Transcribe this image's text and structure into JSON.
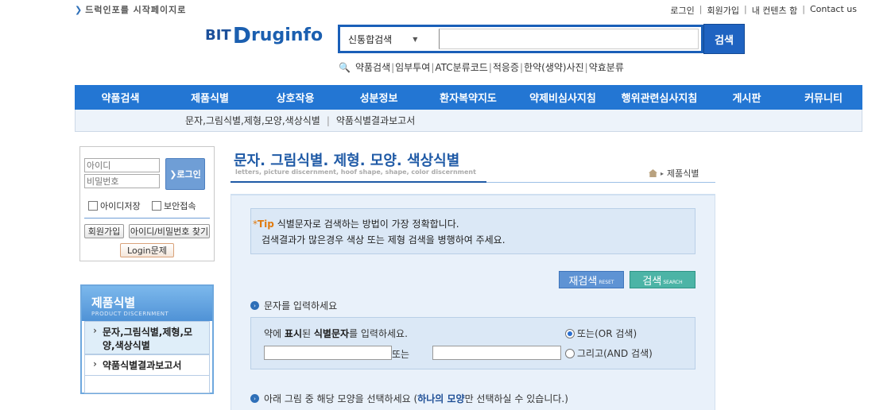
{
  "top": {
    "start_page": "드럭인포를 시작페이지로",
    "links": [
      "로그인",
      "회원가입",
      "내 컨텐츠 함",
      "Contact us"
    ]
  },
  "logo": {
    "bit": "BIT",
    "d": "D",
    "rest": "ruginfo"
  },
  "search": {
    "select_value": "신통합검색",
    "button": "검색",
    "quick_links": [
      "약품검색",
      "임부투여",
      "ATC분류코드",
      "적응증",
      "한약(생약)사진",
      "약효분류"
    ]
  },
  "nav": {
    "items": [
      "약품검색",
      "제품식별",
      "상호작용",
      "성분정보",
      "환자복약지도",
      "약제비심사지침",
      "행위관련심사지침",
      "게시판",
      "커뮤니티"
    ],
    "sub": [
      "문자,그림식별,제형,모양,색상식별",
      "약품식별결과보고서"
    ]
  },
  "login": {
    "id_placeholder": "아이디",
    "pw_placeholder": "비밀번호",
    "button": "로그인",
    "save_id": "아이디저장",
    "secure": "보안접속",
    "join": "회원가입",
    "find": "아이디/비밀번호 찾기",
    "problem": "Login문제"
  },
  "side": {
    "title": "제품식별",
    "subtitle": "PRODUCT DISCERNMENT",
    "items": [
      "문자,그림식별,제형,모양,색상식별",
      "약품식별결과보고서"
    ]
  },
  "content": {
    "title": "문자. 그림식별. 제형. 모양. 색상식별",
    "subtitle": "letters, picture discernment, hoof shape, shape, color discernment",
    "breadcrumb": "제품식별",
    "tip_label": "Tip",
    "tip_line1": "식별문자로 검색하는 방법이 가장 정확합니다.",
    "tip_line2": "검색결과가 많은경우 색상 또는 제형 검색을 병행하여 주세요.",
    "reset_label": "재검색",
    "reset_small": "RESET",
    "search_label": "검색",
    "search_small": "SEARCH",
    "section1": "문자를 입력하세요",
    "input_label_pre": "약에 ",
    "input_label_b1": "표시",
    "input_label_mid": "된 ",
    "input_label_b2": "식별문자",
    "input_label_post": "를 입력하세요.",
    "or_label": "또는",
    "radio_or": "또는(OR 검색)",
    "radio_and": "그리고(AND 검색)",
    "section2_pre": "아래 그림 중 해당 모양을 선택하세요 (",
    "section2_hl": "하나의 모양",
    "section2_post": "만 선택하실 수 있습니다.)"
  }
}
